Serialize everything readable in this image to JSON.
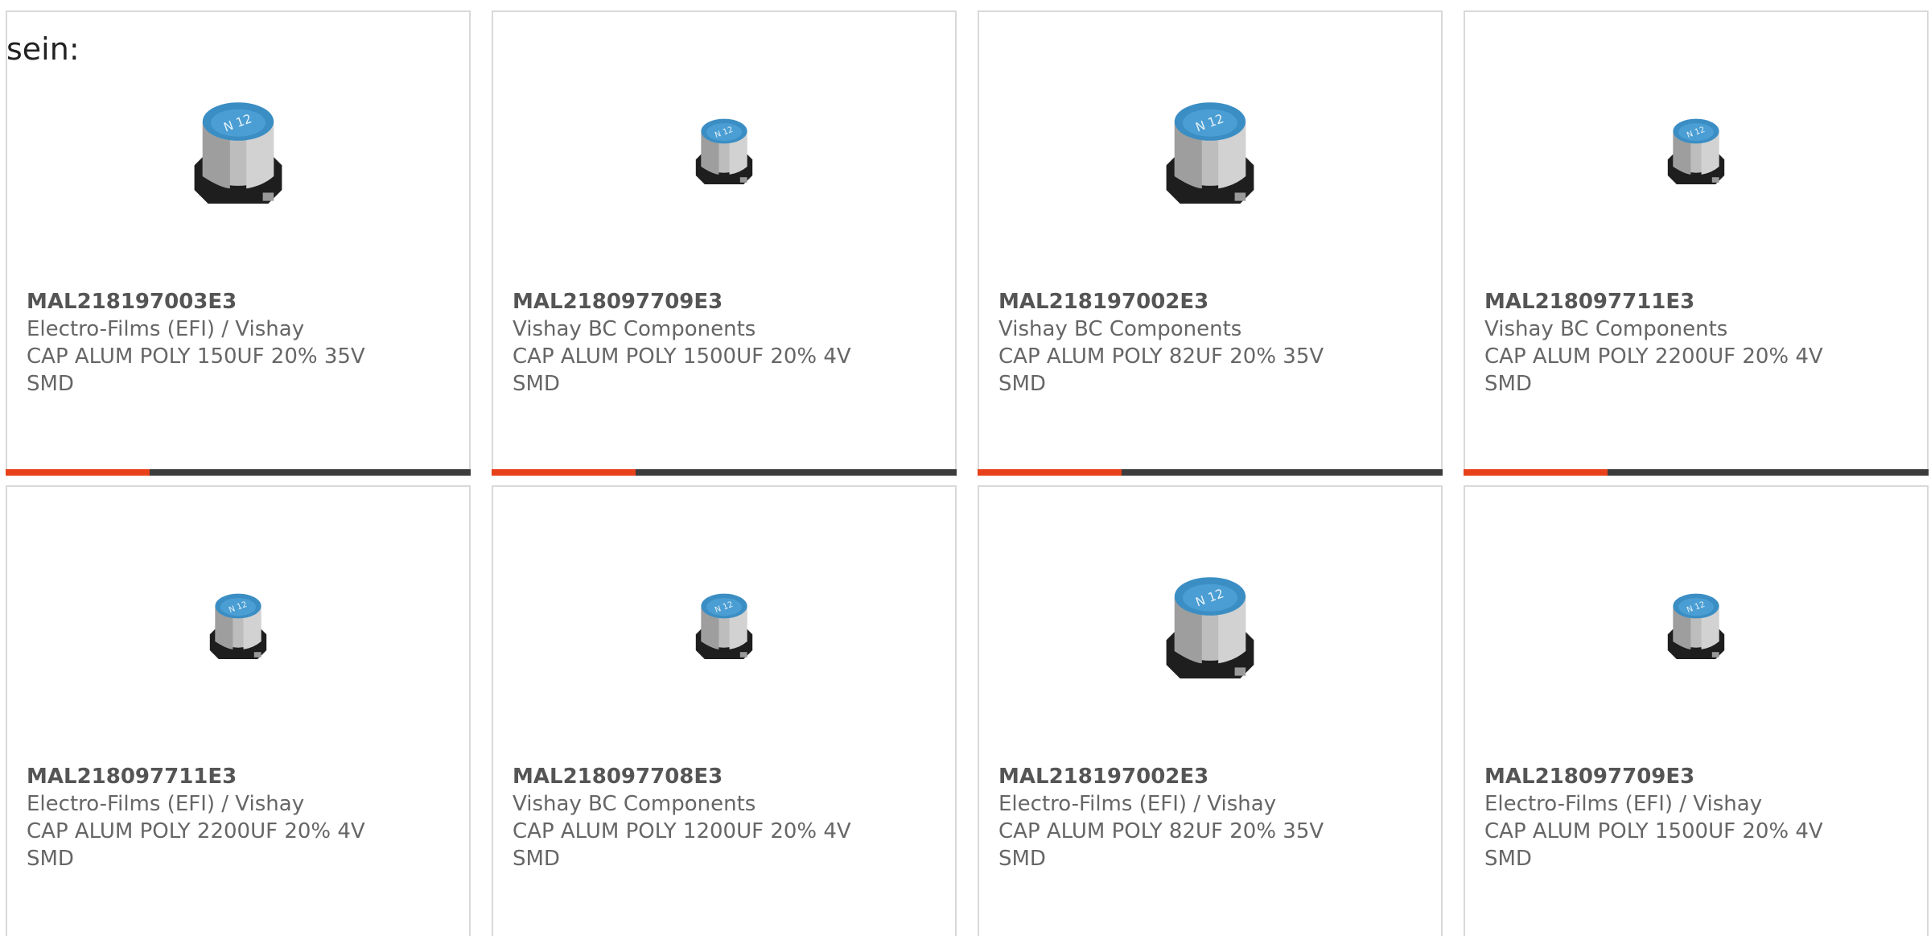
{
  "intro_text": "sein:",
  "colors": {
    "accent": "#e8411a",
    "track": "#3c3c3c",
    "border": "#d9d9d9",
    "text": "#666666",
    "cap_top": "#3b8ec4",
    "cap_body": "#b9b9b9",
    "cap_base": "#1e1e1e"
  },
  "cards": [
    {
      "part_number": "MAL218197003E3",
      "manufacturer": "Electro-Films (EFI) / Vishay",
      "description": "CAP ALUM POLY 150UF 20% 35V",
      "package": "SMD",
      "image": "large",
      "progress": 0.31
    },
    {
      "part_number": "MAL218097709E3",
      "manufacturer": "Vishay BC Components",
      "description": "CAP ALUM POLY 1500UF 20% 4V",
      "package": "SMD",
      "image": "small",
      "progress": 0.31
    },
    {
      "part_number": "MAL218197002E3",
      "manufacturer": "Vishay BC Components",
      "description": "CAP ALUM POLY 82UF 20% 35V",
      "package": "SMD",
      "image": "large",
      "progress": 0.31
    },
    {
      "part_number": "MAL218097711E3",
      "manufacturer": "Vishay BC Components",
      "description": "CAP ALUM POLY 2200UF 20% 4V",
      "package": "SMD",
      "image": "small",
      "progress": 0.31
    },
    {
      "part_number": "MAL218097711E3",
      "manufacturer": "Electro-Films (EFI) / Vishay",
      "description": "CAP ALUM POLY 2200UF 20% 4V",
      "package": "SMD",
      "image": "small"
    },
    {
      "part_number": "MAL218097708E3",
      "manufacturer": "Vishay BC Components",
      "description": "CAP ALUM POLY 1200UF 20% 4V",
      "package": "SMD",
      "image": "small"
    },
    {
      "part_number": "MAL218197002E3",
      "manufacturer": "Electro-Films (EFI) / Vishay",
      "description": "CAP ALUM POLY 82UF 20% 35V",
      "package": "SMD",
      "image": "large"
    },
    {
      "part_number": "MAL218097709E3",
      "manufacturer": "Electro-Films (EFI) / Vishay",
      "description": "CAP ALUM POLY 1500UF 20% 4V",
      "package": "SMD",
      "image": "small"
    }
  ]
}
